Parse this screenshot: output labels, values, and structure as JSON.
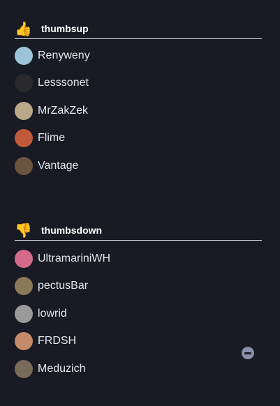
{
  "sections": [
    {
      "emoji": "👍",
      "title": "thumbsup",
      "users": [
        {
          "name": "Renyweny",
          "avatar_color": "#9cc4d6"
        },
        {
          "name": "Lesssonet",
          "avatar_color": "#2a2a2e"
        },
        {
          "name": "MrZakZek",
          "avatar_color": "#b9a98a"
        },
        {
          "name": "Flime",
          "avatar_color": "#c05a3a"
        },
        {
          "name": "Vantage",
          "avatar_color": "#6b5440"
        }
      ]
    },
    {
      "emoji": "👎",
      "title": "thumbsdown",
      "users": [
        {
          "name": "UltramariniWH",
          "avatar_color": "#d46a8a"
        },
        {
          "name": "pectusBar",
          "avatar_color": "#8a7a5a"
        },
        {
          "name": "lowrid",
          "avatar_color": "#9a9a9a"
        },
        {
          "name": "FRDSH",
          "avatar_color": "#c48a6a"
        },
        {
          "name": "Meduzich",
          "avatar_color": "#7a6a5a"
        }
      ]
    }
  ],
  "colors": {
    "background": "#181a24",
    "divider": "#cfd2dc",
    "remove_button": "#8a90a8"
  },
  "icons": {
    "remove": "minus-circle-icon"
  }
}
